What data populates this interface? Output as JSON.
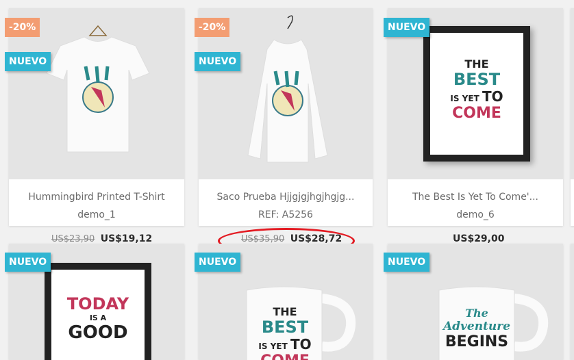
{
  "badges": {
    "new": "NUEVO",
    "discount": "-20%"
  },
  "products": [
    {
      "name": "Hummingbird Printed T-Shirt",
      "sub": "demo_1",
      "old_price": "US$23,90",
      "price": "US$19,12"
    },
    {
      "name": "Saco Prueba Hjjgjgjhgjhgjg...",
      "sub": "REF: A5256",
      "old_price": "US$35,90",
      "price": "US$28,72"
    },
    {
      "name": "The Best Is Yet To Come'...",
      "sub": "demo_6",
      "old_price": "",
      "price": "US$29,00"
    }
  ],
  "artwork": {
    "best": {
      "the": "THE",
      "best": "BEST",
      "is_yet": "IS YET",
      "to": "TO",
      "come": "COME"
    },
    "today": {
      "today": "TODAY",
      "is_a": "IS A",
      "good": "GOOD"
    },
    "adventure": {
      "the": "The",
      "adventure": "Adventure",
      "begins": "BEGINS"
    }
  },
  "colors": {
    "badge_new": "#2fb5d2",
    "badge_discount": "#f39d72",
    "annotation": "#e31b23"
  }
}
